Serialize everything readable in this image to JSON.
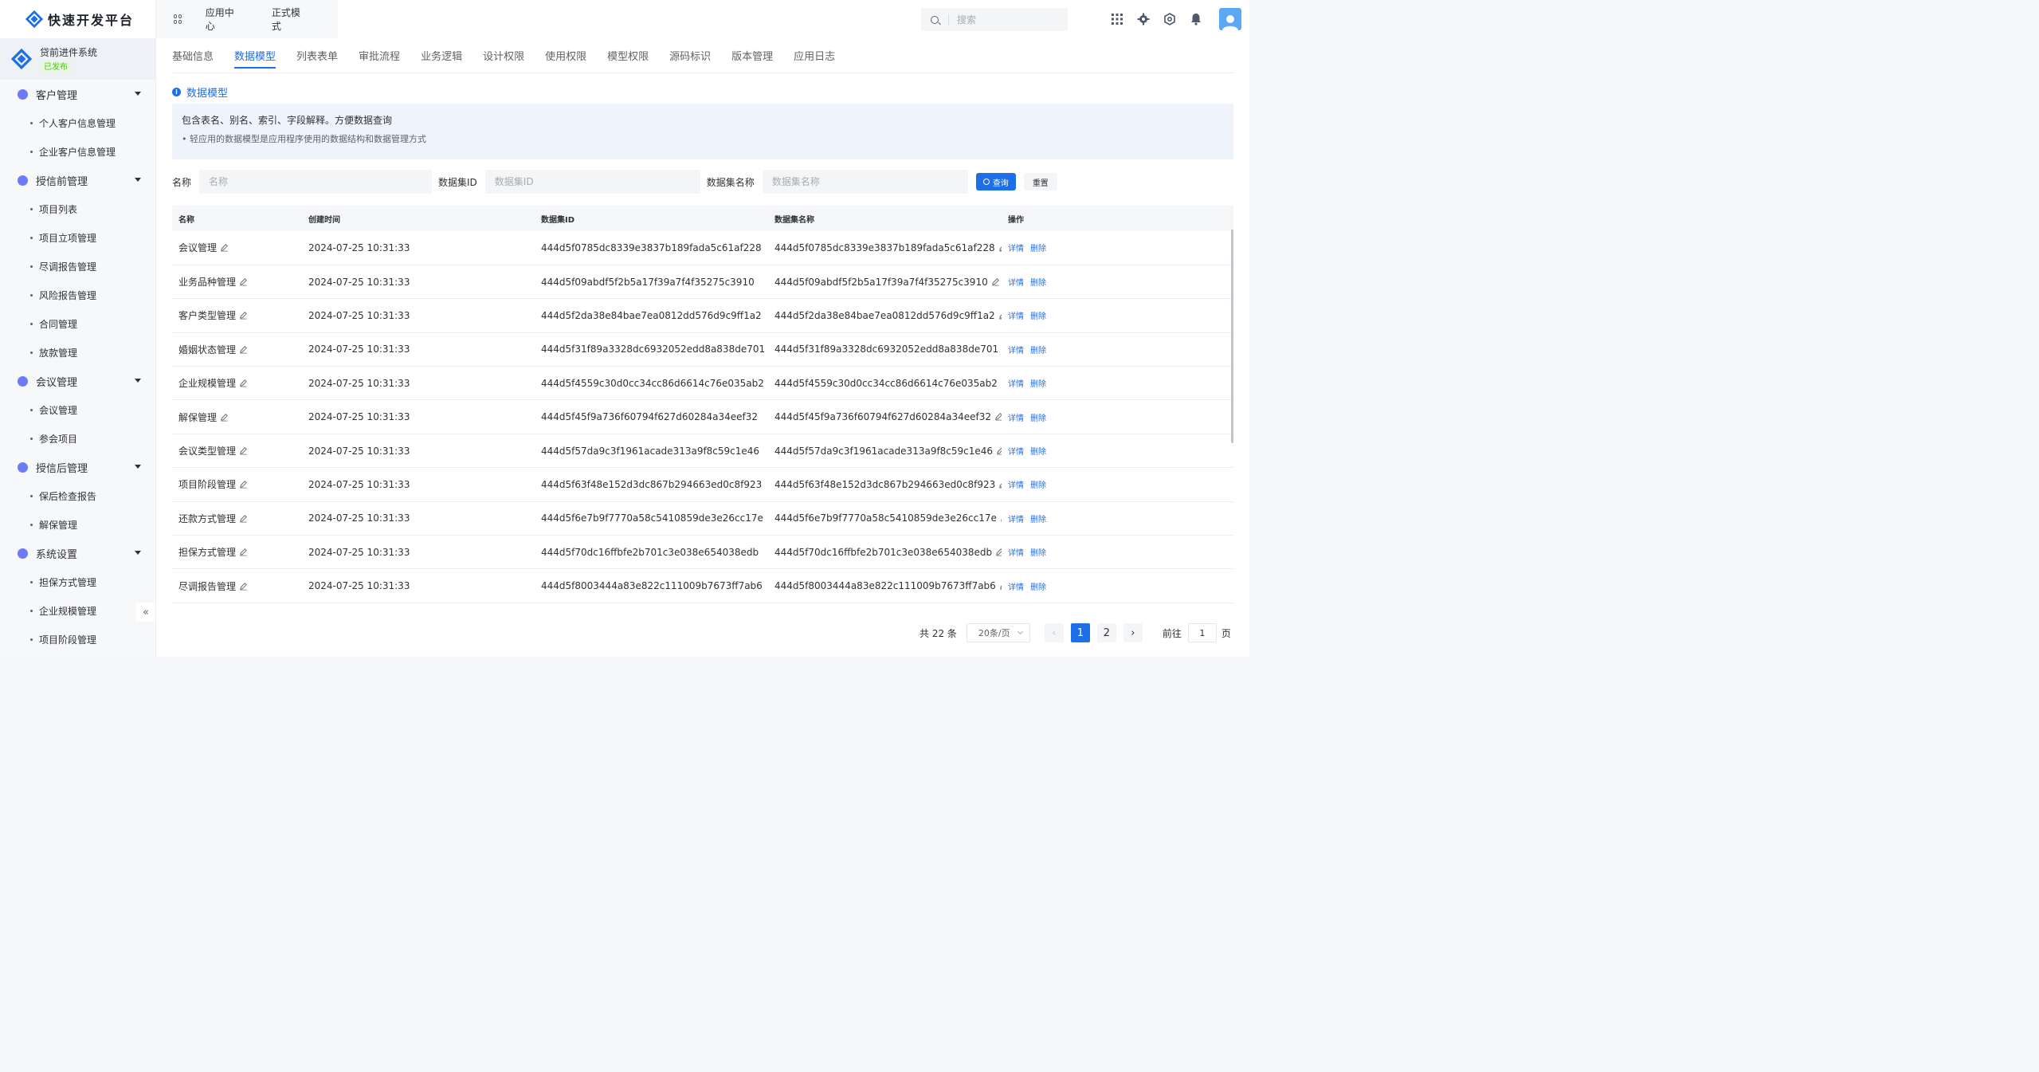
{
  "brand": {
    "title": "快速开发平台"
  },
  "app": {
    "name": "贷前进件系统",
    "status": "已发布"
  },
  "top_tabs": [
    "应用中心",
    "正式模式"
  ],
  "search": {
    "placeholder": "搜索"
  },
  "sidebar": {
    "groups": [
      {
        "label": "客户管理",
        "items": [
          "个人客户信息管理",
          "企业客户信息管理"
        ]
      },
      {
        "label": "授信前管理",
        "items": [
          "项目列表",
          "项目立项管理",
          "尽调报告管理",
          "风险报告管理",
          "合同管理",
          "放款管理"
        ]
      },
      {
        "label": "会议管理",
        "items": [
          "会议管理",
          "参会项目"
        ]
      },
      {
        "label": "授信后管理",
        "items": [
          "保后检查报告",
          "解保管理"
        ]
      },
      {
        "label": "系统设置",
        "items": [
          "担保方式管理",
          "企业规模管理",
          "项目阶段管理"
        ]
      }
    ],
    "collapse_label": "«"
  },
  "sub_tabs": [
    "基础信息",
    "数据模型",
    "列表表单",
    "审批流程",
    "业务逻辑",
    "设计权限",
    "使用权限",
    "模型权限",
    "源码标识",
    "版本管理",
    "应用日志"
  ],
  "active_tab": "数据模型",
  "section": {
    "title": "数据模型",
    "notice_main": "包含表名、别名、索引、字段解释。方便数据查询",
    "notice_sub": "• 轻应用的数据模型是应用程序使用的数据结构和数据管理方式"
  },
  "filters": {
    "name_label": "名称",
    "name_placeholder": "名称",
    "dsid_label": "数据集ID",
    "dsid_placeholder": "数据集ID",
    "dsname_label": "数据集名称",
    "dsname_placeholder": "数据集名称",
    "query_label": "查询",
    "reset_label": "重置"
  },
  "table": {
    "headers": [
      "名称",
      "创建时间",
      "数据集ID",
      "数据集名称",
      "操作"
    ],
    "op_detail": "详情",
    "op_delete": "删除",
    "rows": [
      {
        "name": "会议管理",
        "time": "2024-07-25 10:31:33",
        "dsid": "444d5f0785dc8339e3837b189fada5c61af228",
        "dsname": "444d5f0785dc8339e3837b189fada5c61af228"
      },
      {
        "name": "业务品种管理",
        "time": "2024-07-25 10:31:33",
        "dsid": "444d5f09abdf5f2b5a17f39a7f4f35275c3910",
        "dsname": "444d5f09abdf5f2b5a17f39a7f4f35275c3910"
      },
      {
        "name": "客户类型管理",
        "time": "2024-07-25 10:31:33",
        "dsid": "444d5f2da38e84bae7ea0812dd576d9c9ff1a2",
        "dsname": "444d5f2da38e84bae7ea0812dd576d9c9ff1a2"
      },
      {
        "name": "婚姻状态管理",
        "time": "2024-07-25 10:31:33",
        "dsid": "444d5f31f89a3328dc6932052edd8a838de701",
        "dsname": "444d5f31f89a3328dc6932052edd8a838de701"
      },
      {
        "name": "企业规模管理",
        "time": "2024-07-25 10:31:33",
        "dsid": "444d5f4559c30d0cc34cc86d6614c76e035ab2",
        "dsname": "444d5f4559c30d0cc34cc86d6614c76e035ab2"
      },
      {
        "name": "解保管理",
        "time": "2024-07-25 10:31:33",
        "dsid": "444d5f45f9a736f60794f627d60284a34eef32",
        "dsname": "444d5f45f9a736f60794f627d60284a34eef32"
      },
      {
        "name": "会议类型管理",
        "time": "2024-07-25 10:31:33",
        "dsid": "444d5f57da9c3f1961acade313a9f8c59c1e46",
        "dsname": "444d5f57da9c3f1961acade313a9f8c59c1e46"
      },
      {
        "name": "项目阶段管理",
        "time": "2024-07-25 10:31:33",
        "dsid": "444d5f63f48e152d3dc867b294663ed0c8f923",
        "dsname": "444d5f63f48e152d3dc867b294663ed0c8f923"
      },
      {
        "name": "还款方式管理",
        "time": "2024-07-25 10:31:33",
        "dsid": "444d5f6e7b9f7770a58c5410859de3e26cc17e",
        "dsname": "444d5f6e7b9f7770a58c5410859de3e26cc17e"
      },
      {
        "name": "担保方式管理",
        "time": "2024-07-25 10:31:33",
        "dsid": "444d5f70dc16ffbfe2b701c3e038e654038edb",
        "dsname": "444d5f70dc16ffbfe2b701c3e038e654038edb"
      },
      {
        "name": "尽调报告管理",
        "time": "2024-07-25 10:31:33",
        "dsid": "444d5f8003444a83e822c111009b7673ff7ab6",
        "dsname": "444d5f8003444a83e822c111009b7673ff7ab6"
      }
    ]
  },
  "pagination": {
    "total_text": "共 22 条",
    "page_size": "20条/页",
    "pages": [
      "1",
      "2"
    ],
    "current": "1",
    "goto_label": "前往",
    "goto_value": "1",
    "goto_unit": "页"
  },
  "colors": {
    "primary": "#1d6fe8",
    "success": "#52c41a",
    "menu_icon": "#6d7cf6"
  }
}
